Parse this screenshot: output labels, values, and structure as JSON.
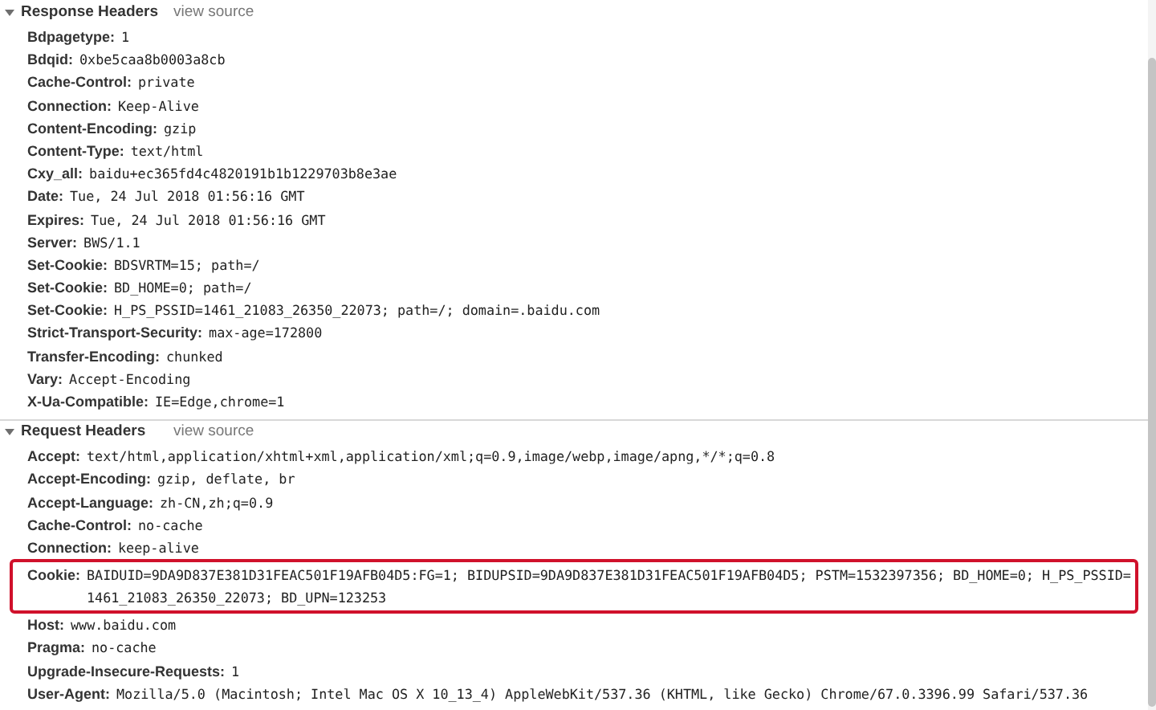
{
  "sections": [
    {
      "title": "Response Headers",
      "expanded": true,
      "link": "view source",
      "headers": [
        {
          "name": "Bdpagetype:",
          "value": "1",
          "highlighted": false
        },
        {
          "name": "Bdqid:",
          "value": "0xbe5caa8b0003a8cb",
          "highlighted": false
        },
        {
          "name": "Cache-Control:",
          "value": "private",
          "highlighted": false
        },
        {
          "name": "Connection:",
          "value": "Keep-Alive",
          "highlighted": false
        },
        {
          "name": "Content-Encoding:",
          "value": "gzip",
          "highlighted": false
        },
        {
          "name": "Content-Type:",
          "value": "text/html",
          "highlighted": false
        },
        {
          "name": "Cxy_all:",
          "value": "baidu+ec365fd4c4820191b1b1229703b8e3ae",
          "highlighted": false
        },
        {
          "name": "Date:",
          "value": "Tue, 24 Jul 2018 01:56:16 GMT",
          "highlighted": false
        },
        {
          "name": "Expires:",
          "value": "Tue, 24 Jul 2018 01:56:16 GMT",
          "highlighted": false
        },
        {
          "name": "Server:",
          "value": "BWS/1.1",
          "highlighted": false
        },
        {
          "name": "Set-Cookie:",
          "value": "BDSVRTM=15; path=/",
          "highlighted": false
        },
        {
          "name": "Set-Cookie:",
          "value": "BD_HOME=0; path=/",
          "highlighted": false
        },
        {
          "name": "Set-Cookie:",
          "value": "H_PS_PSSID=1461_21083_26350_22073; path=/; domain=.baidu.com",
          "highlighted": false
        },
        {
          "name": "Strict-Transport-Security:",
          "value": "max-age=172800",
          "highlighted": false
        },
        {
          "name": "Transfer-Encoding:",
          "value": "chunked",
          "highlighted": false
        },
        {
          "name": "Vary:",
          "value": "Accept-Encoding",
          "highlighted": false
        },
        {
          "name": "X-Ua-Compatible:",
          "value": "IE=Edge,chrome=1",
          "highlighted": false
        }
      ]
    },
    {
      "title": "Request Headers",
      "expanded": true,
      "link": "view source",
      "headers": [
        {
          "name": "Accept:",
          "value": "text/html,application/xhtml+xml,application/xml;q=0.9,image/webp,image/apng,*/*;q=0.8",
          "highlighted": false
        },
        {
          "name": "Accept-Encoding:",
          "value": "gzip, deflate, br",
          "highlighted": false
        },
        {
          "name": "Accept-Language:",
          "value": "zh-CN,zh;q=0.9",
          "highlighted": false
        },
        {
          "name": "Cache-Control:",
          "value": "no-cache",
          "highlighted": false
        },
        {
          "name": "Connection:",
          "value": "keep-alive",
          "highlighted": false
        },
        {
          "name": "Cookie:",
          "value": "BAIDUID=9DA9D837E381D31FEAC501F19AFB04D5:FG=1; BIDUPSID=9DA9D837E381D31FEAC501F19AFB04D5; PSTM=1532397356; BD_HOME=0; H_PS_PSSID=1461_21083_26350_22073; BD_UPN=123253",
          "highlighted": true
        },
        {
          "name": "Host:",
          "value": "www.baidu.com",
          "highlighted": false
        },
        {
          "name": "Pragma:",
          "value": "no-cache",
          "highlighted": false
        },
        {
          "name": "Upgrade-Insecure-Requests:",
          "value": "1",
          "highlighted": false
        },
        {
          "name": "User-Agent:",
          "value": "Mozilla/5.0 (Macintosh; Intel Mac OS X 10_13_4) AppleWebKit/537.36 (KHTML, like Gecko) Chrome/67.0.3396.99 Safari/537.36",
          "highlighted": false
        }
      ]
    }
  ]
}
